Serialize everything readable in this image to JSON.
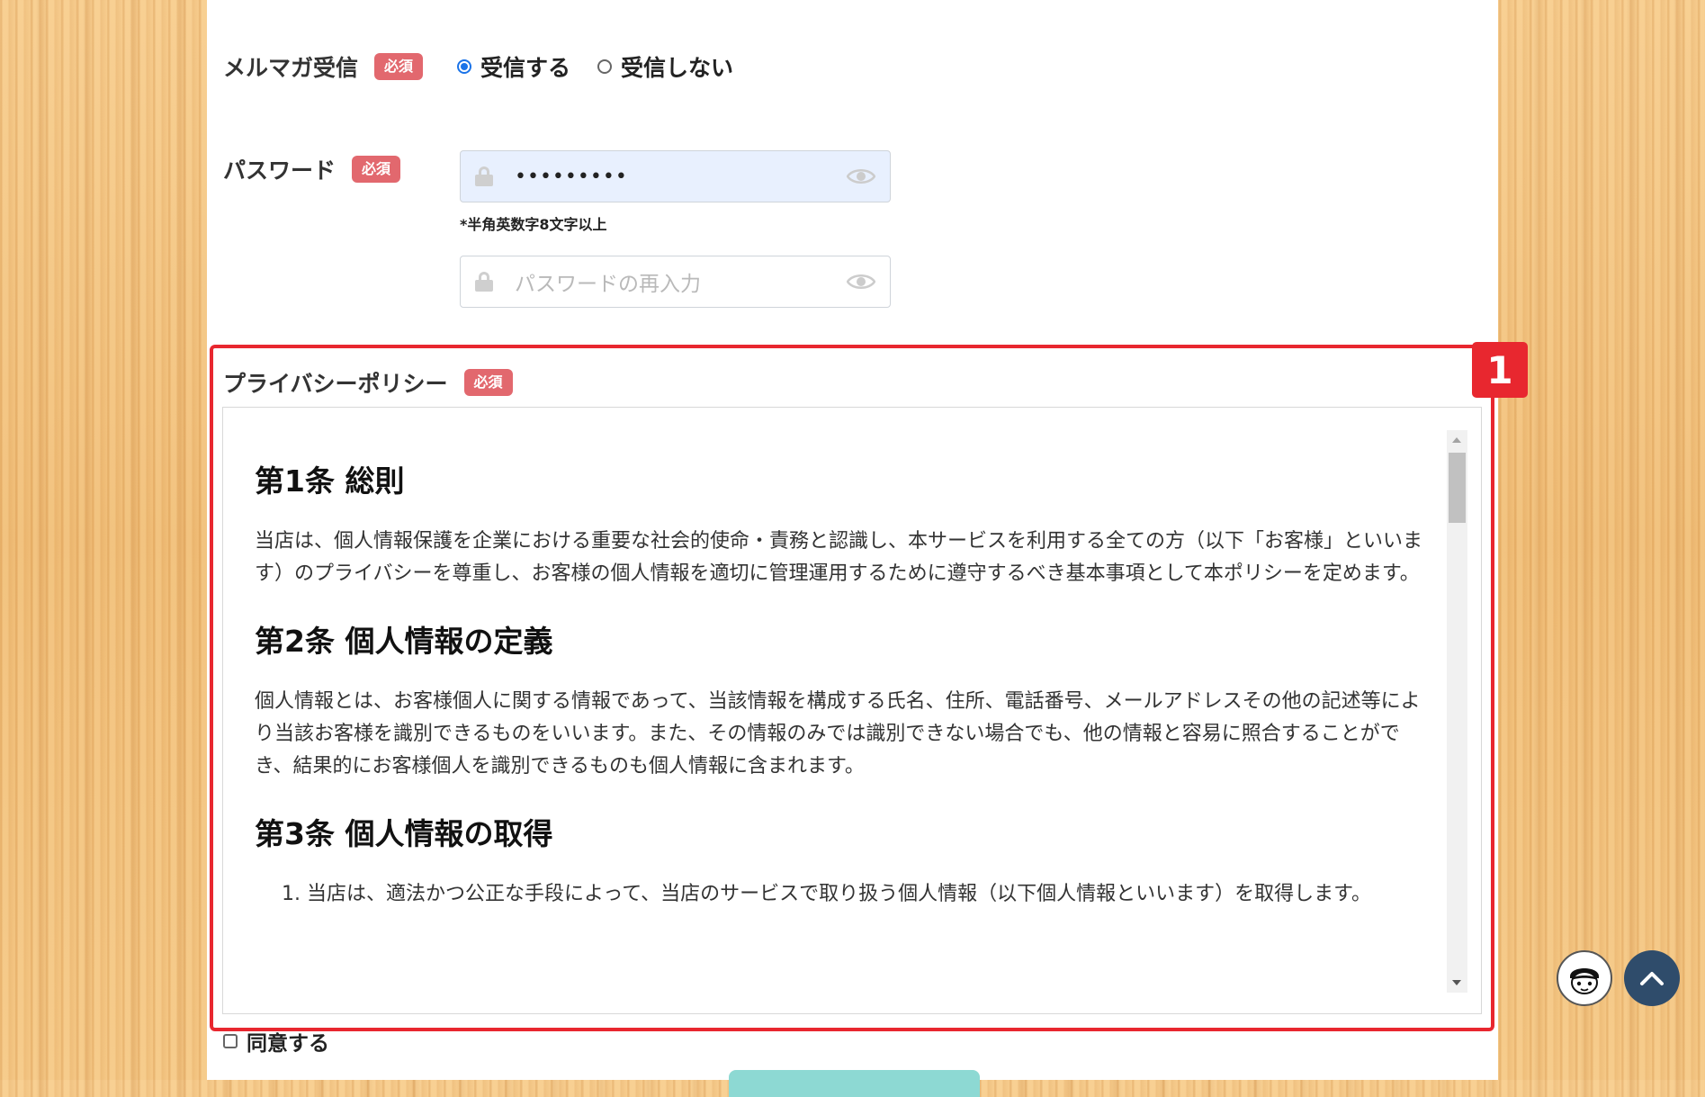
{
  "newsletter": {
    "label": "メルマガ受信",
    "required_badge": "必須",
    "options": [
      {
        "label": "受信する",
        "checked": true
      },
      {
        "label": "受信しない",
        "checked": false
      }
    ]
  },
  "password": {
    "label": "パスワード",
    "required_badge": "必須",
    "value": "•••••••••",
    "hint": "*半角英数字8文字以上",
    "confirm_placeholder": "パスワードの再入力"
  },
  "privacy": {
    "label": "プライバシーポリシー",
    "required_badge": "必須",
    "annotation_number": "1",
    "sections": [
      {
        "title": "第1条 総則",
        "text": "当店は、個人情報保護を企業における重要な社会的使命・責務と認識し、本サービスを利用する全ての方（以下「お客様」といいます）のプライバシーを尊重し、お客様の個人情報を適切に管理運用するために遵守するべき基本事項として本ポリシーを定めます。"
      },
      {
        "title": "第2条 個人情報の定義",
        "text": "個人情報とは、お客様個人に関する情報であって、当該情報を構成する氏名、住所、電話番号、メールアドレスその他の記述等により当該お客様を識別できるものをいいます。また、その情報のみでは識別できない場合でも、他の情報と容易に照合することができ、結果的にお客様個人を識別できるものも個人情報に含まれます。"
      },
      {
        "title": "第3条 個人情報の取得",
        "items": [
          "当店は、適法かつ公正な手段によって、当店のサービスで取り扱う個人情報（以下個人情報といいます）を取得します。"
        ]
      }
    ]
  },
  "agree": {
    "label": "同意する"
  },
  "colors": {
    "required": "#e2686e",
    "highlight": "#e8272f",
    "accent": "#1a73e8",
    "scroll_top": "#2f4c6b"
  }
}
